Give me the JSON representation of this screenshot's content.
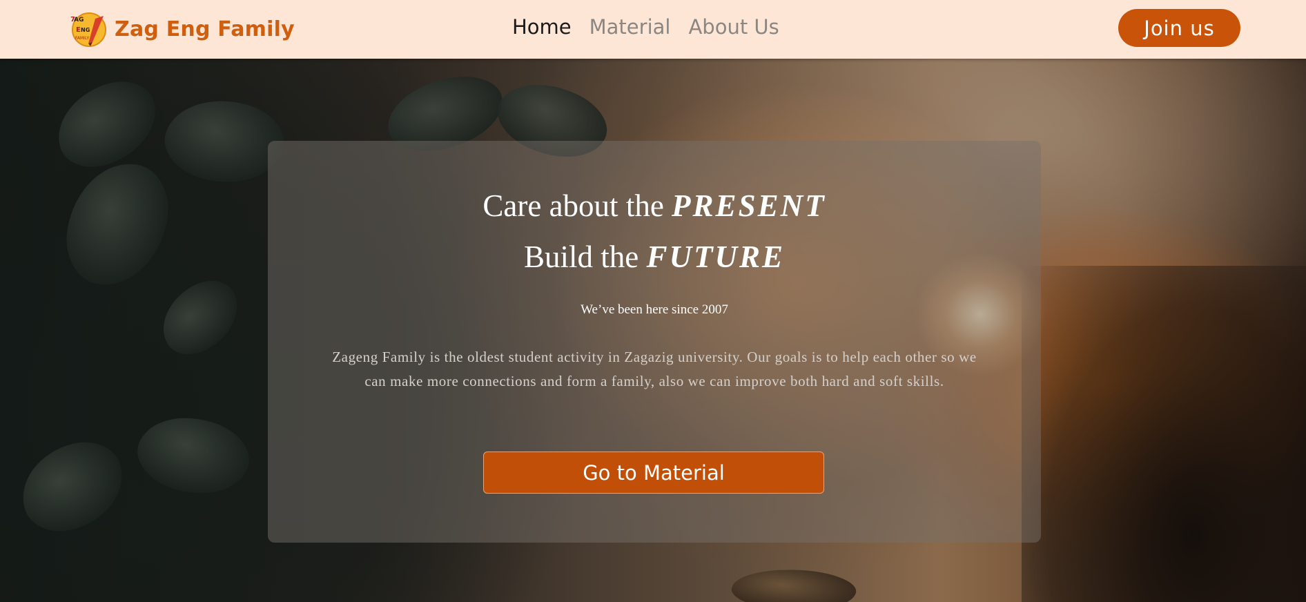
{
  "navbar": {
    "brand_name": "Zag Eng Family",
    "brand_logo_text": "ZAG ENG FAMILY",
    "links": [
      {
        "label": "Home",
        "active": true
      },
      {
        "label": "Material",
        "active": false
      },
      {
        "label": "About Us",
        "active": false
      }
    ],
    "join_label": "Join us"
  },
  "hero": {
    "headline_1_prefix": "Care about the ",
    "headline_1_emphasis": "PRESENT",
    "headline_2_prefix": "Build the ",
    "headline_2_emphasis": "FUTURE",
    "since": "We’ve been here since 2007",
    "description": "Zageng Family is the oldest student activity in Zagazig university. Our goals is to help each other so we can make more connections and form a family, also we can improve both hard and soft skills.",
    "cta_label": "Go to Material"
  },
  "colors": {
    "navbar_bg": "#fde6d6",
    "brand": "#cf5f0f",
    "accent": "#c95308",
    "cta": "#c24f07"
  }
}
